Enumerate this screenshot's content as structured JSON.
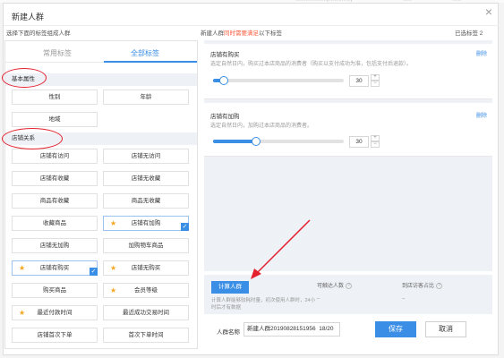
{
  "topstrip": {
    "left": "…………………(……………)",
    "mid": "……",
    "right": "……"
  },
  "modal": {
    "title": "新建人群",
    "close_icon": "close-icon"
  },
  "left": {
    "header": "选择下面的标签组成人群",
    "tabs": [
      "常用标签",
      "全部标签"
    ],
    "active_tab": 1,
    "sections": {
      "basic": "基本属性",
      "store": "店铺关系"
    },
    "basic_tags": [
      "性别",
      "年龄",
      "地域"
    ],
    "store_tags": [
      {
        "label": "店铺有访问",
        "star": false,
        "checked": false
      },
      {
        "label": "店铺无访问",
        "star": false,
        "checked": false
      },
      {
        "label": "店铺有收藏",
        "star": false,
        "checked": false
      },
      {
        "label": "店铺无收藏",
        "star": false,
        "checked": false
      },
      {
        "label": "商品有收藏",
        "star": false,
        "checked": false
      },
      {
        "label": "商品无收藏",
        "star": false,
        "checked": false
      },
      {
        "label": "收藏商品",
        "star": false,
        "checked": false
      },
      {
        "label": "店铺有加购",
        "star": true,
        "checked": true
      },
      {
        "label": "店铺无加购",
        "star": false,
        "checked": false
      },
      {
        "label": "加购物车商品",
        "star": false,
        "checked": false
      },
      {
        "label": "店铺有购买",
        "star": true,
        "checked": true
      },
      {
        "label": "店铺无购买",
        "star": true,
        "checked": false
      },
      {
        "label": "购买商品",
        "star": false,
        "checked": false
      },
      {
        "label": "会员等级",
        "star": true,
        "checked": false
      },
      {
        "label": "最近付款时间",
        "star": true,
        "checked": false
      },
      {
        "label": "最近成功交易时间",
        "star": false,
        "checked": false
      },
      {
        "label": "店铺首次下单",
        "star": false,
        "checked": false
      },
      {
        "label": "首次下单时间",
        "star": false,
        "checked": false
      }
    ]
  },
  "right": {
    "header_pre": "新建人群",
    "header_red": "同时需要满足",
    "header_post": "以下标签",
    "selected_count": "已选标签 2",
    "cards": [
      {
        "title": "店铺有购买",
        "desc": "选定自然日内，购买过本店商品的消费者（购买以支付成功为准，包括支付后退款）。",
        "delete": "删除",
        "value": "30",
        "level": 0.08
      },
      {
        "title": "店铺有加购",
        "desc": "选定自然日内，加购过本店商品的消费者。",
        "delete": "删除",
        "value": "30",
        "level": 0.33
      }
    ],
    "calc": {
      "button": "计算人群",
      "reachable_label": "可触达人数",
      "visitor_label": "到店访客占比",
      "reachable_value": "–",
      "visitor_value": "–",
      "note": "计算人群能够较耗时量，初次使用人群时，24小时后才有数据"
    },
    "name_label": "人群名称",
    "name_value": "新建人群20190828151956",
    "name_count": "18/20",
    "save": "保存",
    "cancel": "取消"
  }
}
